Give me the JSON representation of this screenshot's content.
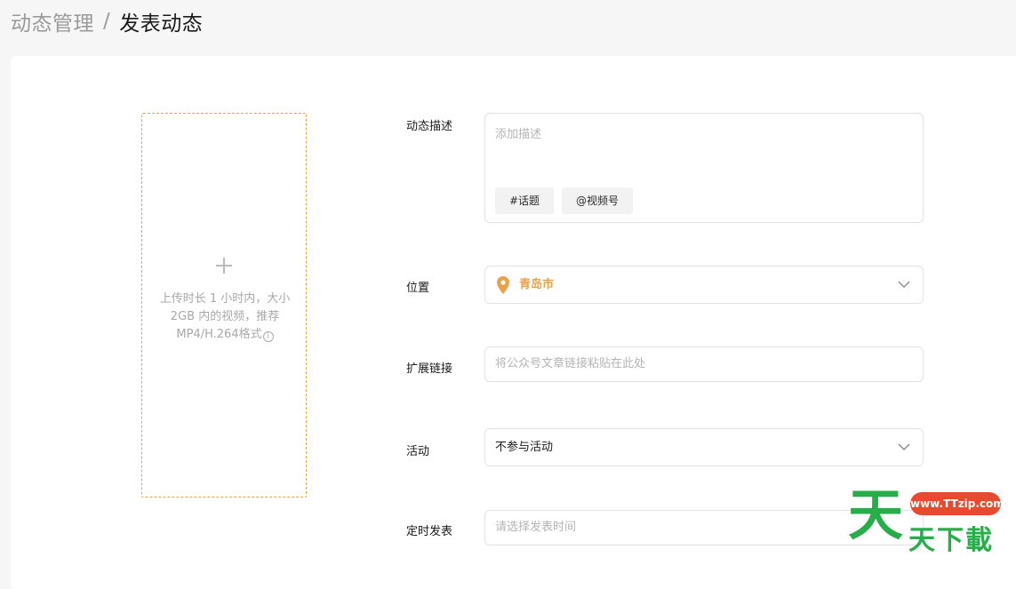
{
  "breadcrumb": {
    "parent": "动态管理",
    "separator": "/",
    "current": "发表动态"
  },
  "upload": {
    "hint": "上传时长 1 小时内，大小 2GB 内的视频，推荐MP4/H.264格式",
    "info_icon": "i"
  },
  "form": {
    "description": {
      "label": "动态描述",
      "placeholder": "添加描述",
      "tag_topic": "#话题",
      "tag_channel": "@视频号"
    },
    "location": {
      "label": "位置",
      "value": "青岛市"
    },
    "link": {
      "label": "扩展链接",
      "placeholder": "将公众号文章链接粘贴在此处"
    },
    "activity": {
      "label": "活动",
      "value": "不参与活动"
    },
    "schedule": {
      "label": "定时发表",
      "placeholder": "请选择发表时间"
    }
  },
  "watermark": {
    "url": "www.TTzip.com",
    "big_char": "天",
    "text": "天下載"
  },
  "colors": {
    "accent": "#e9a24a",
    "watermark_green": "#27ad4a",
    "watermark_red": "#e64b2e"
  },
  "icons": {
    "upload": "plus-icon",
    "location": "map-pin-icon",
    "dropdown": "chevron-down-icon",
    "info": "info-icon"
  }
}
